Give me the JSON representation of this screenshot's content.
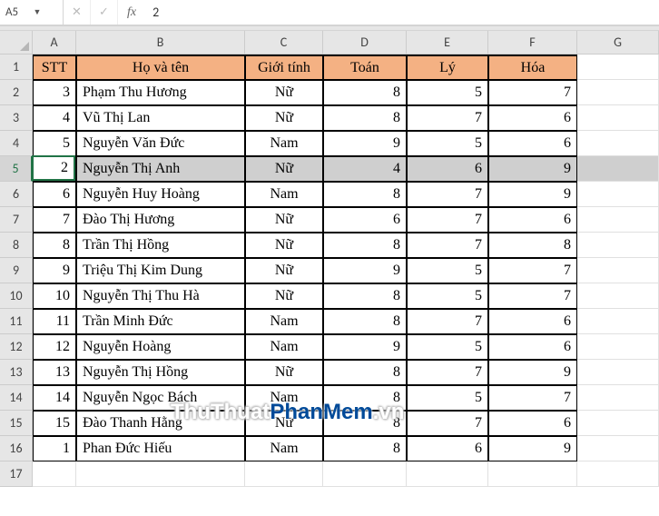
{
  "namebox": "A5",
  "formula": "2",
  "fx_cancel": "✕",
  "fx_confirm": "✓",
  "fx_label": "fx",
  "colWidths": {
    "A": 48,
    "B": 186,
    "C": 86,
    "D": 92,
    "E": 90,
    "F": 98,
    "G": 90
  },
  "columns": [
    "A",
    "B",
    "C",
    "D",
    "E",
    "F",
    "G"
  ],
  "headers": {
    "A": "STT",
    "B": "Họ và tên",
    "C": "Giới tính",
    "D": "Toán",
    "E": "Lý",
    "F": "Hóa"
  },
  "selectedRow": 5,
  "activeCell": {
    "row": 5,
    "col": "A",
    "value": "2"
  },
  "rows": [
    {
      "n": 2,
      "A": "3",
      "B": "Phạm Thu Hương",
      "C": "Nữ",
      "D": "8",
      "E": "5",
      "F": "7"
    },
    {
      "n": 3,
      "A": "4",
      "B": "Vũ Thị Lan",
      "C": "Nữ",
      "D": "8",
      "E": "7",
      "F": "6"
    },
    {
      "n": 4,
      "A": "5",
      "B": "Nguyễn Văn Đức",
      "C": "Nam",
      "D": "9",
      "E": "5",
      "F": "6"
    },
    {
      "n": 5,
      "A": "2",
      "B": "Nguyễn Thị Anh",
      "C": "Nữ",
      "D": "4",
      "E": "6",
      "F": "9"
    },
    {
      "n": 6,
      "A": "6",
      "B": "Nguyễn Huy Hoàng",
      "C": "Nam",
      "D": "8",
      "E": "7",
      "F": "9"
    },
    {
      "n": 7,
      "A": "7",
      "B": "Đào Thị Hương",
      "C": "Nữ",
      "D": "6",
      "E": "7",
      "F": "6"
    },
    {
      "n": 8,
      "A": "8",
      "B": "Trần Thị Hồng",
      "C": "Nữ",
      "D": "8",
      "E": "7",
      "F": "8"
    },
    {
      "n": 9,
      "A": "9",
      "B": "Triệu Thị Kim Dung",
      "C": "Nữ",
      "D": "9",
      "E": "5",
      "F": "7"
    },
    {
      "n": 10,
      "A": "10",
      "B": "Nguyễn Thị Thu Hà",
      "C": "Nữ",
      "D": "8",
      "E": "5",
      "F": "7"
    },
    {
      "n": 11,
      "A": "11",
      "B": "Trần Minh Đức",
      "C": "Nam",
      "D": "8",
      "E": "7",
      "F": "6"
    },
    {
      "n": 12,
      "A": "12",
      "B": "Nguyễn Hoàng",
      "C": "Nam",
      "D": "9",
      "E": "5",
      "F": "6"
    },
    {
      "n": 13,
      "A": "13",
      "B": "Nguyễn Thị Hồng",
      "C": "Nữ",
      "D": "8",
      "E": "7",
      "F": "9"
    },
    {
      "n": 14,
      "A": "14",
      "B": "Nguyễn Ngọc Bách",
      "C": "Nam",
      "D": "8",
      "E": "5",
      "F": "7"
    },
    {
      "n": 15,
      "A": "15",
      "B": "Đào Thanh Hằng",
      "C": "Nữ",
      "D": "8",
      "E": "7",
      "F": "6"
    },
    {
      "n": 16,
      "A": "1",
      "B": "Phan Đức Hiếu",
      "C": "Nam",
      "D": "8",
      "E": "6",
      "F": "9"
    }
  ],
  "emptyRow": 17,
  "watermark": {
    "t1": "ThuThuat",
    "t2": "PhanMem",
    "t3": ".vn"
  }
}
